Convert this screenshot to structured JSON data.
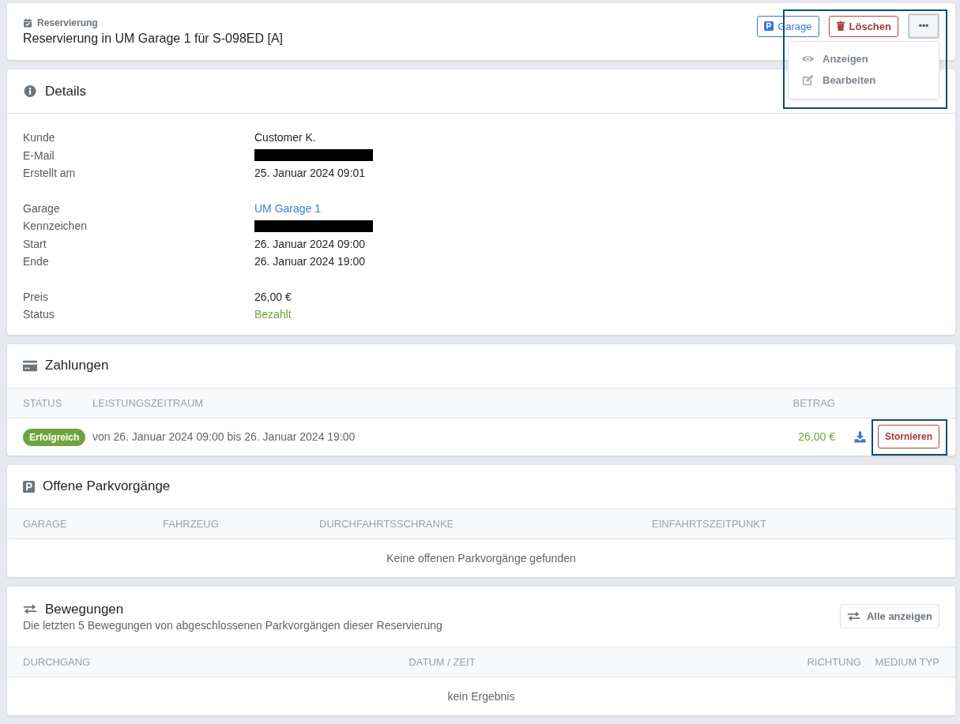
{
  "header": {
    "kicker": "Reservierung",
    "title": "Reservierung in UM Garage 1 für S-098ED [A]",
    "buttons": [
      {
        "label": "Garage",
        "kind": "garage"
      },
      {
        "label": "Löschen",
        "kind": "delete"
      },
      {
        "label": "•••",
        "kind": "more",
        "open": true
      }
    ],
    "menu": [
      {
        "label": "Anzeigen",
        "kind": "view"
      },
      {
        "label": "Bearbeiten",
        "kind": "edit"
      }
    ],
    "highlighted": true
  },
  "details": {
    "title": "Details",
    "groups": [
      [
        {
          "label": "Kunde",
          "value": "Customer K.",
          "kind": "text"
        },
        {
          "label": "E-Mail",
          "kind": "redacted"
        },
        {
          "label": "Erstellt am",
          "value": "25. Januar 2024 09:01",
          "kind": "text"
        }
      ],
      [
        {
          "label": "Garage",
          "value": "UM Garage 1",
          "kind": "link"
        },
        {
          "label": "Kennzeichen",
          "kind": "redacted"
        },
        {
          "label": "Start",
          "value": "26. Januar 2024 09:00",
          "kind": "text"
        },
        {
          "label": "Ende",
          "value": "26. Januar 2024 19:00",
          "kind": "text"
        }
      ],
      [
        {
          "label": "Preis",
          "value": "26,00 €",
          "kind": "text"
        },
        {
          "label": "Status",
          "value": "Bezahlt",
          "kind": "success"
        }
      ]
    ]
  },
  "payments": {
    "title": "Zahlungen",
    "columns": [
      "STATUS",
      "LEISTUNGSZEITRAUM",
      "BETRAG"
    ],
    "rows": [
      {
        "status": "Erfolgreich",
        "period": "von 26. Januar 2024 09:00 bis 26. Januar 2024 19:00",
        "amount": "26,00 €",
        "action": "Stornieren",
        "highlighted": true
      }
    ]
  },
  "open_parkings": {
    "title": "Offene Parkvorgänge",
    "columns": [
      "GARAGE",
      "FAHRZEUG",
      "DURCHFAHRTSSCHRANKE",
      "EINFAHRTSZEITPUNKT"
    ],
    "empty": "Keine offenen Parkvorgänge gefunden"
  },
  "movements": {
    "title": "Bewegungen",
    "subtitle": "Die letzten 5 Bewegungen von abgeschlossenen Parkvorgängen dieser Reservierung",
    "button": "Alle anzeigen",
    "columns": [
      "DURCHGANG",
      "DATUM / ZEIT",
      "RICHTUNG",
      "MEDIUM TYP"
    ],
    "empty": "kein Ergebnis"
  }
}
